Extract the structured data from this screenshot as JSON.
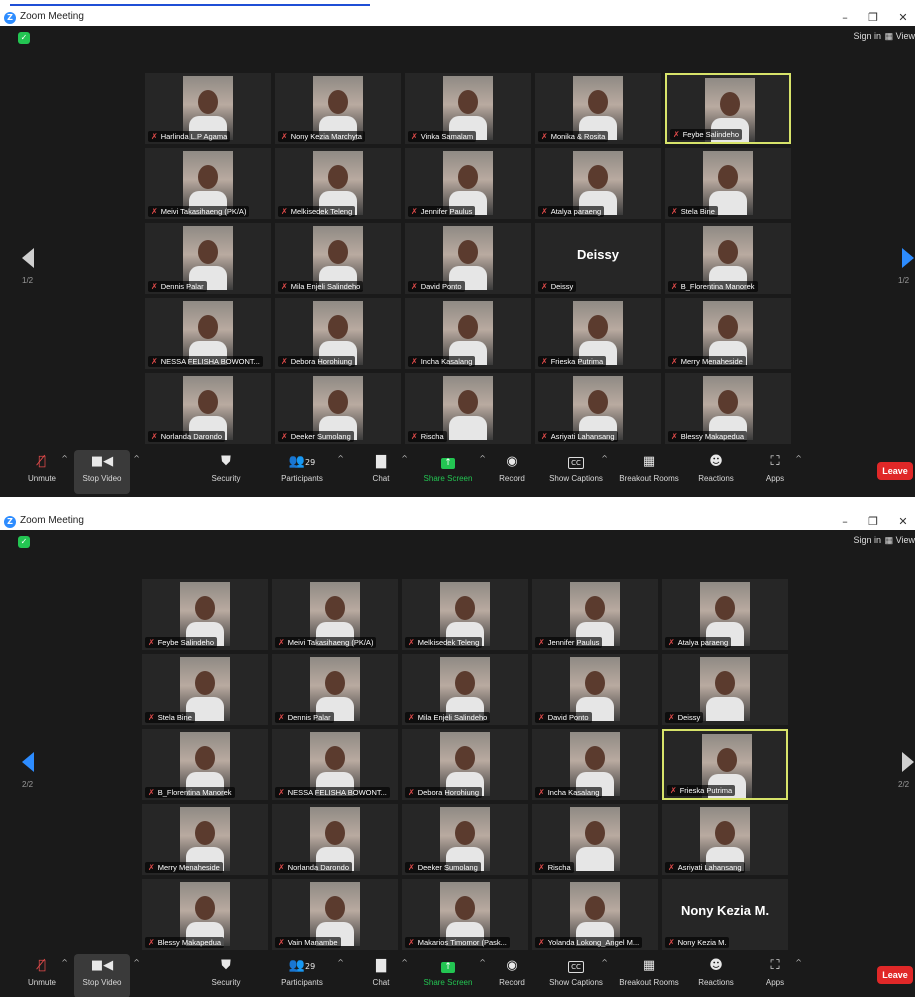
{
  "windows": [
    {
      "title": "Zoom Meeting",
      "sign_in": "Sign in",
      "view": "View",
      "page_indicator": "1/2",
      "page_indicator_right": "1/2",
      "participants_count": "29",
      "tiles": [
        {
          "name": "Harlinda L.P Agama",
          "big": ""
        },
        {
          "name": "Nony Kezia Marchyta",
          "big": ""
        },
        {
          "name": "Vinka Samalam",
          "big": ""
        },
        {
          "name": "Monika & Rosita",
          "big": ""
        },
        {
          "name": "Feybe Salindeho",
          "big": "",
          "active": true
        },
        {
          "name": "Meivi Takasihaeng (PK/A)",
          "big": ""
        },
        {
          "name": "Melkisedek Teleng",
          "big": ""
        },
        {
          "name": "Jennifer Paulus",
          "big": ""
        },
        {
          "name": "Atalya paraeng",
          "big": ""
        },
        {
          "name": "Stela Bine",
          "big": ""
        },
        {
          "name": "Dennis Palar",
          "big": ""
        },
        {
          "name": "Mila Enjeli Salindeho",
          "big": ""
        },
        {
          "name": "David Ponto",
          "big": ""
        },
        {
          "name": "Deissy",
          "big": "Deissy"
        },
        {
          "name": "B_Florentina Manorek",
          "big": ""
        },
        {
          "name": "NESSA FELISHA BOWONT...",
          "big": ""
        },
        {
          "name": "Debora Horohiung",
          "big": ""
        },
        {
          "name": "Incha Kasalang",
          "big": ""
        },
        {
          "name": "Frieska Putrima",
          "big": ""
        },
        {
          "name": "Merry Menaheside",
          "big": ""
        },
        {
          "name": "Norlanda Darondo",
          "big": ""
        },
        {
          "name": "Deeker Sumolang",
          "big": ""
        },
        {
          "name": "Rischa",
          "big": ""
        },
        {
          "name": "Asriyati Lahansang",
          "big": ""
        },
        {
          "name": "Blessy Makapedua",
          "big": ""
        }
      ]
    },
    {
      "title": "Zoom Meeting",
      "sign_in": "Sign in",
      "view": "View",
      "page_indicator": "2/2",
      "page_indicator_right": "2/2",
      "participants_count": "29",
      "tiles": [
        {
          "name": "Feybe Salindeho",
          "big": ""
        },
        {
          "name": "Meivi Takasihaeng (PK/A)",
          "big": ""
        },
        {
          "name": "Melkisedek Teleng",
          "big": ""
        },
        {
          "name": "Jennifer Paulus",
          "big": ""
        },
        {
          "name": "Atalya paraeng",
          "big": ""
        },
        {
          "name": "Stela Bine",
          "big": ""
        },
        {
          "name": "Dennis Palar",
          "big": ""
        },
        {
          "name": "Mila Enjeli Salindeho",
          "big": ""
        },
        {
          "name": "David Ponto",
          "big": ""
        },
        {
          "name": "Deissy",
          "big": ""
        },
        {
          "name": "B_Florentina Manorek",
          "big": ""
        },
        {
          "name": "NESSA FELISHA BOWONT...",
          "big": ""
        },
        {
          "name": "Debora Horohiung",
          "big": ""
        },
        {
          "name": "Incha Kasalang",
          "big": ""
        },
        {
          "name": "Frieska Putrima",
          "big": "",
          "active": true
        },
        {
          "name": "Merry Menaheside",
          "big": ""
        },
        {
          "name": "Norlanda Darondo",
          "big": ""
        },
        {
          "name": "Deeker Sumolang",
          "big": ""
        },
        {
          "name": "Rischa",
          "big": ""
        },
        {
          "name": "Asriyati Lahansang",
          "big": ""
        },
        {
          "name": "Blessy Makapedua",
          "big": ""
        },
        {
          "name": "Vain Manambe",
          "big": ""
        },
        {
          "name": "Makarios Timomor (Pask...",
          "big": ""
        },
        {
          "name": "Yolanda Lokong_Angel M...",
          "big": ""
        },
        {
          "name": "Nony Kezia M.",
          "big": "Nony Kezia M."
        }
      ]
    }
  ],
  "toolbar": {
    "unmute": "Unmute",
    "stop_video": "Stop Video",
    "security": "Security",
    "participants": "Participants",
    "chat": "Chat",
    "share_screen": "Share Screen",
    "record": "Record",
    "show_captions": "Show Captions",
    "breakout_rooms": "Breakout Rooms",
    "reactions": "Reactions",
    "apps": "Apps",
    "leave": "Leave",
    "cc": "CC"
  },
  "colors": {
    "accent_blue": "#2d8cff",
    "share_green": "#23c552",
    "leave_red": "#e02828",
    "active_speaker": "#d7e36a"
  }
}
